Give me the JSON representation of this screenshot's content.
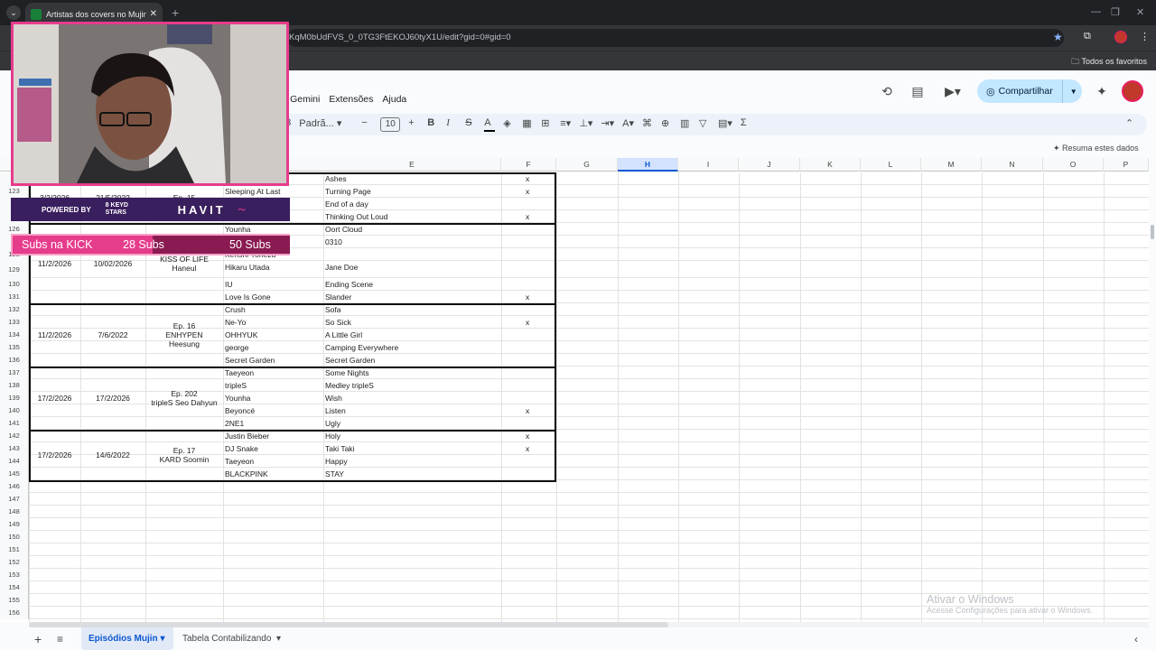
{
  "browser": {
    "tab_title": "Artistas dos covers no Mujin - G",
    "url": "KqM0bUdFVS_0_0TG3FtEKOJ60tyX1U/edit?gid=0#gid=0",
    "bookmarks_all": "Todos os favoritos"
  },
  "menu": [
    "as",
    "Gemini",
    "Extensões",
    "Ajuda"
  ],
  "share_label": "Compartilhar",
  "toolbar": {
    "num_format": "23",
    "font_name": "Padrã...",
    "font_size": "10"
  },
  "summarize_label": "Resuma estes dados",
  "columns": [
    "E",
    "F",
    "G",
    "H",
    "I",
    "J",
    "K",
    "L",
    "M",
    "N",
    "O",
    "P"
  ],
  "selected_column": "H",
  "row_numbers": [
    "1",
    "123",
    "1",
    "1",
    "126",
    "1",
    "128",
    "129",
    "130",
    "131",
    "132",
    "133",
    "134",
    "135",
    "136",
    "137",
    "138",
    "139",
    "140",
    "141",
    "142",
    "143",
    "144",
    "145",
    "146",
    "147",
    "148",
    "149",
    "150",
    "151",
    "152",
    "153",
    "154",
    "155",
    "156"
  ],
  "cells": {
    "artists": [
      [
        "",
        "Sleeping At Last",
        "",
        ""
      ],
      [
        "Younha",
        "",
        "Kenshi Yonezu",
        "Hikaru Utada",
        "IU",
        "Love Is Gone"
      ],
      [
        "Crush",
        "Ne-Yo",
        "OHHYUK",
        "george",
        "Secret Garden"
      ],
      [
        "Taeyeon",
        "tripleS",
        "Younha",
        "Beyoncé",
        "2NE1"
      ],
      [
        "Justin Bieber",
        "DJ Snake",
        "Taeyeon",
        "BLACKPINK"
      ]
    ],
    "songs": [
      [
        "Ashes",
        "Turning Page",
        "End of a day",
        "Thinking Out Loud"
      ],
      [
        "Oort Cloud",
        "0310",
        "Jane Doe",
        "Ending Scene",
        "Slander"
      ],
      [
        "Sofa",
        "So Sick",
        "A Little Girl",
        "Camping Everywhere",
        "Secret Garden"
      ],
      [
        "Some Nights",
        "Medley tripleS",
        "Wish",
        "Listen",
        "Ugly"
      ],
      [
        "Holy",
        "Taki Taki",
        "Happy",
        "STAY"
      ]
    ],
    "marks": [
      "x",
      "x",
      "x",
      "x",
      "x",
      "x",
      "x",
      "x"
    ],
    "groups": [
      {
        "date1": "3/2/2026",
        "date2": "21/5/2022",
        "ep": "Ep. 15"
      },
      {
        "date1": "11/2/2026",
        "date2": "10/02/2026",
        "ep": "KISS OF LIFE\nHaneul"
      },
      {
        "date1": "11/2/2026",
        "date2": "7/6/2022",
        "ep": "Ep. 16\nENHYPEN\nHeesung"
      },
      {
        "date1": "17/2/2026",
        "date2": "17/2/2026",
        "ep": "Ep. 202\ntripleS Seo Dahyun"
      },
      {
        "date1": "17/2/2026",
        "date2": "14/6/2022",
        "ep": "Ep. 17\nKARD Soomin"
      }
    ]
  },
  "sheet_tabs": [
    "Episódios Mujin",
    "Tabela Contabilizando"
  ],
  "watermark": {
    "title": "Ativar o Windows",
    "subtitle": "Acesse Configurações para ativar o Windows."
  },
  "overlay": {
    "powered_by": "POWERED BY",
    "sponsor1": "8 KEYD STARS",
    "sponsor2": "HAVIT",
    "subs_label": "Subs na KICK",
    "subs_current": "28 Subs",
    "subs_goal": "50 Subs"
  }
}
